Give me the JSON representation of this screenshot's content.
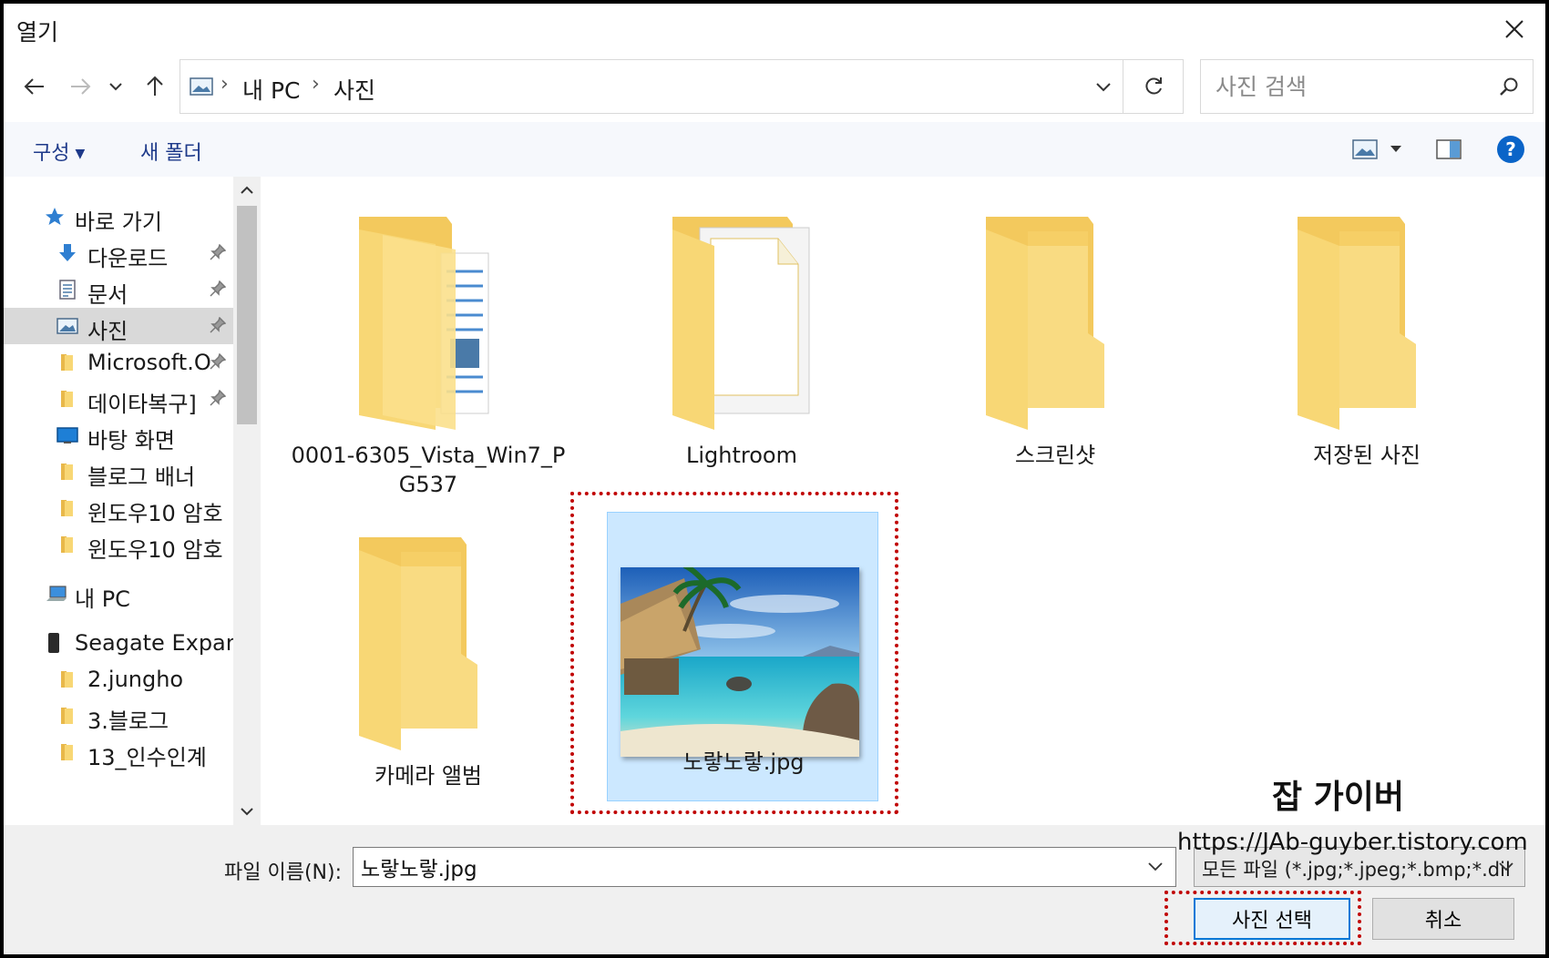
{
  "window": {
    "title": "열기"
  },
  "address": {
    "crumbs": [
      "내 PC",
      "사진"
    ],
    "search_placeholder": "사진 검색"
  },
  "commands": {
    "organize": "구성",
    "new_folder": "새 폴더"
  },
  "nav": {
    "items": [
      {
        "label": "바로 가기",
        "icon": "star-icon",
        "pinned": false
      },
      {
        "label": "다운로드",
        "icon": "download-icon",
        "pinned": true
      },
      {
        "label": "문서",
        "icon": "document-icon",
        "pinned": true
      },
      {
        "label": "사진",
        "icon": "pictures-icon",
        "pinned": true,
        "selected": true
      },
      {
        "label": "Microsoft.O",
        "icon": "folder-icon",
        "pinned": true
      },
      {
        "label": "데이타복구]",
        "icon": "folder-icon",
        "pinned": true
      },
      {
        "label": "바탕 화면",
        "icon": "desktop-icon",
        "pinned": false
      },
      {
        "label": "블로그 배너",
        "icon": "folder-icon",
        "pinned": false
      },
      {
        "label": "윈도우10 암호",
        "icon": "folder-icon",
        "pinned": false
      },
      {
        "label": "윈도우10 암호",
        "icon": "folder-icon",
        "pinned": false
      },
      {
        "label": "내 PC",
        "icon": "pc-icon",
        "pinned": false
      },
      {
        "label": "Seagate Expans",
        "icon": "drive-icon",
        "pinned": false
      },
      {
        "label": "2.jungho",
        "icon": "folder-icon",
        "pinned": false
      },
      {
        "label": "3.블로그",
        "icon": "folder-icon",
        "pinned": false
      },
      {
        "label": "13_인수인계",
        "icon": "folder-icon",
        "pinned": false
      }
    ]
  },
  "files": [
    {
      "name": "0001-6305_Vista_Win7_P\nG537",
      "line1": "0001-6305_Vista_Win7_P",
      "line2": "G537",
      "type": "folder-docs"
    },
    {
      "name": "Lightroom",
      "type": "folder-paper"
    },
    {
      "name": "스크린샷",
      "type": "folder"
    },
    {
      "name": "저장된 사진",
      "type": "folder"
    },
    {
      "name": "카메라 앨범",
      "type": "folder"
    },
    {
      "name": "노랗노랗.jpg",
      "type": "image",
      "selected": true
    }
  ],
  "watermark": {
    "title": "잡 가이버",
    "url": "https://JAb-guyber.tistory.com"
  },
  "footer": {
    "filename_label": "파일 이름(N):",
    "filename_value": "노랗노랗.jpg",
    "filter": "모든 파일 (*.jpg;*.jpeg;*.bmp;*.dil",
    "open_button": "사진 선택",
    "cancel_button": "취소"
  },
  "colors": {
    "accent": "#0078d7",
    "selection": "#cce8ff",
    "highlight": "#c00000",
    "folder": "#f8d775"
  }
}
